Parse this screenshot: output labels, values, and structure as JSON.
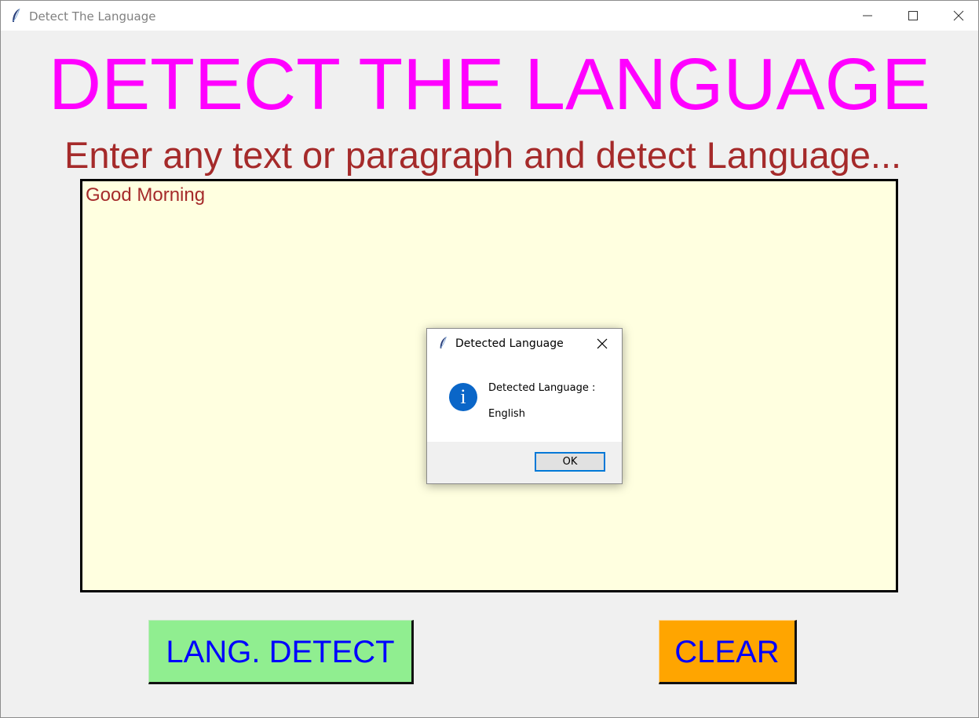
{
  "window": {
    "title": "Detect The Language"
  },
  "main": {
    "heading": "DETECT THE LANGUAGE",
    "subheading": "Enter any text or paragraph and detect Language...",
    "text_input_value": "Good Morning",
    "detect_button_label": "LANG. DETECT",
    "clear_button_label": "CLEAR"
  },
  "dialog": {
    "title": "Detected Language",
    "message_line1": "Detected Language :",
    "message_line2": "English",
    "ok_label": "OK",
    "icon": "info-icon"
  },
  "colors": {
    "heading": "#ff00ff",
    "subheading": "#a52a2a",
    "textarea_bg": "#ffffe0",
    "detect_button_bg": "#90ee90",
    "clear_button_bg": "#ffa500",
    "button_text": "#0000ff"
  }
}
